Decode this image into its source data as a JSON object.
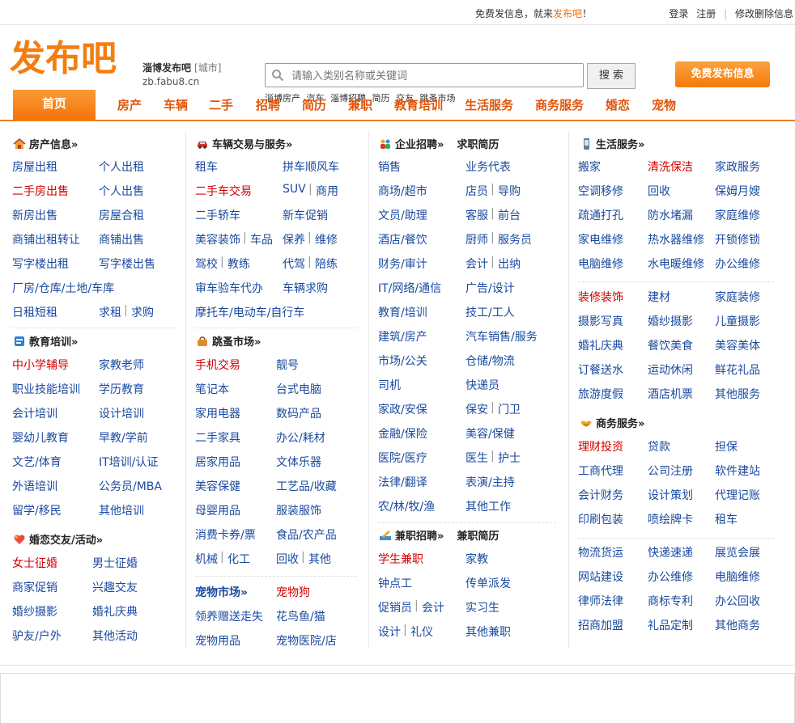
{
  "topbar": {
    "center_prefix": "免费发信息，就来",
    "center_brand": "发布吧",
    "center_suffix": "！",
    "login": "登录",
    "register": "注册",
    "sep": "|",
    "manage": "修改删除信息"
  },
  "header": {
    "logo_text": "发布吧",
    "site_name": "淄博发布吧",
    "city_tag": "[城市]",
    "site_url": "zb.fabu8.cn",
    "search_placeholder": "请输入类别名称或关键词",
    "search_button": "搜 索",
    "post_button": "免费发布信息",
    "hotwords": [
      "淄博房产",
      "汽车",
      "淄博招聘",
      "简历",
      "交友",
      "跳蚤市场"
    ]
  },
  "nav": {
    "home": "首页",
    "items": [
      "房产",
      "车辆",
      "二手",
      "招聘",
      "简历",
      "兼职",
      "教育培训",
      "生活服务",
      "商务服务",
      "婚恋",
      "宠物"
    ]
  },
  "colors": {
    "accent": "#f47d10",
    "link": "#1a4aa0",
    "hot": "#d40000",
    "nav_text": "#e2560a"
  },
  "sections": {
    "house": {
      "title": "房产信息»",
      "icon": "house-icon",
      "links": [
        "房屋出租",
        "个人出租",
        "二手房出售",
        "个人出售",
        "新房出售",
        "房屋合租",
        "商铺出租转让",
        "商铺出售",
        "写字楼出租",
        "写字楼出售",
        "厂房/仓库/土地/车库",
        "日租短租",
        "求租",
        "求购"
      ]
    },
    "edu": {
      "title": "教育培训»",
      "icon": "education-icon",
      "links": [
        "中小学辅导",
        "家教老师",
        "职业技能培训",
        "学历教育",
        "会计培训",
        "设计培训",
        "婴幼儿教育",
        "早教/学前",
        "文艺/体育",
        "IT培训/认证",
        "外语培训",
        "公务员/MBA",
        "留学/移民",
        "其他培训"
      ]
    },
    "dating": {
      "title": "婚恋交友/活动»",
      "icon": "heart-icon",
      "links": [
        "女士征婚",
        "男士征婚",
        "商家促销",
        "兴趣交友",
        "婚纱摄影",
        "婚礼庆典",
        "驴友/户外",
        "其他活动"
      ]
    },
    "car": {
      "title": "车辆交易与服务»",
      "icon": "car-icon",
      "links": [
        "租车",
        "拼车顺风车",
        "二手车交易",
        "SUV",
        "商用",
        "二手轿车",
        "新车促销",
        "美容装饰",
        "车品",
        "保养",
        "维修",
        "驾校",
        "教练",
        "代驾",
        "陪练",
        "审车验车代办",
        "车辆求购",
        "摩托车/电动车/自行车"
      ]
    },
    "flea": {
      "title": "跳蚤市场»",
      "icon": "bag-icon",
      "links": [
        "手机交易",
        "靓号",
        "笔记本",
        "台式电脑",
        "家用电器",
        "数码产品",
        "二手家具",
        "办公/耗材",
        "居家用品",
        "文体乐器",
        "美容保健",
        "工艺品/收藏",
        "母婴用品",
        "服装服饰",
        "消费卡券/票",
        "食品/农产品",
        "机械",
        "化工",
        "回收",
        "其他"
      ]
    },
    "pet": {
      "title": "宠物市场»",
      "hot": "宠物狗",
      "links": [
        "领养赠送走失",
        "花鸟鱼/猫",
        "宠物用品",
        "宠物医院/店"
      ]
    },
    "job": {
      "title": "企业招聘»",
      "sub": "求职简历",
      "icon": "people-icon",
      "links": [
        "销售",
        "业务代表",
        "商场/超市",
        "店员",
        "导购",
        "文员/助理",
        "客服",
        "前台",
        "酒店/餐饮",
        "厨师",
        "服务员",
        "财务/审计",
        "会计",
        "出纳",
        "IT/网络/通信",
        "广告/设计",
        "教育/培训",
        "技工/工人",
        "建筑/房产",
        "汽车销售/服务",
        "市场/公关",
        "仓储/物流",
        "司机",
        "快递员",
        "家政/安保",
        "保安",
        "门卫",
        "金融/保险",
        "美容/保健",
        "医院/医疗",
        "医生",
        "护士",
        "法律/翻译",
        "表演/主持",
        "农/林/牧/渔",
        "其他工作"
      ]
    },
    "parttime": {
      "title": "兼职招聘»",
      "sub": "兼职简历",
      "icon": "pen-icon",
      "links": [
        "学生兼职",
        "家教",
        "钟点工",
        "传单派发",
        "促销员",
        "会计",
        "实习生",
        "设计",
        "礼仪",
        "其他兼职"
      ]
    },
    "life": {
      "title": "生活服务»",
      "icon": "phone-icon",
      "links": [
        "搬家",
        "清洗保洁",
        "家政服务",
        "空调移修",
        "回收",
        "保姆月嫂",
        "疏通打孔",
        "防水堵漏",
        "家庭维修",
        "家电维修",
        "热水器维修",
        "开锁修锁",
        "电脑维修",
        "水电暖维修",
        "办公维修",
        "装修装饰",
        "建材",
        "家庭装修",
        "摄影写真",
        "婚纱摄影",
        "儿童摄影",
        "婚礼庆典",
        "餐饮美食",
        "美容美体",
        "订餐送水",
        "运动休闲",
        "鲜花礼品",
        "旅游度假",
        "酒店机票",
        "其他服务"
      ]
    },
    "biz": {
      "title": "商务服务»",
      "icon": "handshake-icon",
      "links": [
        "理财投资",
        "贷款",
        "担保",
        "工商代理",
        "公司注册",
        "软件建站",
        "会计财务",
        "设计策划",
        "代理记账",
        "印刷包装",
        "喷绘牌卡",
        "租车",
        "物流货运",
        "快递速递",
        "展览会展",
        "网站建设",
        "办公维修",
        "电脑维修",
        "律师法律",
        "商标专利",
        "办公回收",
        "招商加盟",
        "礼品定制",
        "其他商务"
      ]
    }
  }
}
